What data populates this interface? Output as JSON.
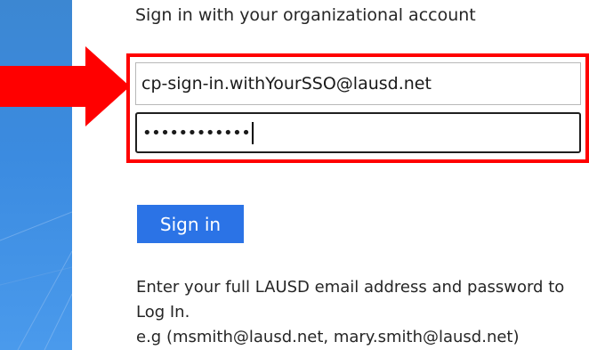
{
  "colors": {
    "accent": "#2b73e6",
    "highlight": "#ff0000",
    "side_panel": "#3b8be0"
  },
  "heading": "Sign in with your organizational account",
  "email_field": {
    "value": "cp-sign-in.withYourSSO@lausd.net"
  },
  "password_field": {
    "masked_value": "••••••••••••"
  },
  "sign_in_button": {
    "label": "Sign in"
  },
  "help_text": {
    "line1": "Enter your full LAUSD email address and password to",
    "line2": "Log In.",
    "line3": "e.g (msmith@lausd.net, mary.smith@lausd.net)"
  },
  "icons": {
    "arrow": "right-arrow-icon"
  }
}
